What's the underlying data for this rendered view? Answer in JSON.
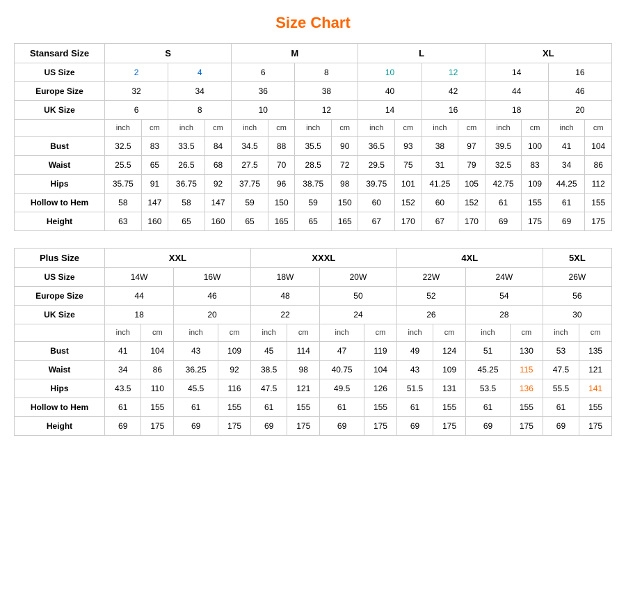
{
  "title": "Size Chart",
  "standard": {
    "label": "Stansard Size",
    "groups": [
      {
        "label": "S",
        "colspan": 4
      },
      {
        "label": "M",
        "colspan": 4
      },
      {
        "label": "L",
        "colspan": 4
      },
      {
        "label": "XL",
        "colspan": 4
      }
    ],
    "us_size": [
      "2",
      "4",
      "6",
      "8",
      "10",
      "12",
      "14",
      "16"
    ],
    "europe_size": [
      "32",
      "34",
      "36",
      "38",
      "40",
      "42",
      "44",
      "46"
    ],
    "uk_size": [
      "6",
      "8",
      "10",
      "12",
      "14",
      "16",
      "18",
      "20"
    ],
    "units": [
      "inch",
      "cm",
      "inch",
      "cm",
      "inch",
      "cm",
      "inch",
      "cm",
      "inch",
      "cm",
      "inch",
      "cm",
      "inch",
      "cm",
      "inch",
      "cm"
    ],
    "rows": [
      {
        "label": "Bust",
        "vals": [
          "32.5",
          "83",
          "33.5",
          "84",
          "34.5",
          "88",
          "35.5",
          "90",
          "36.5",
          "93",
          "38",
          "97",
          "39.5",
          "100",
          "41",
          "104"
        ]
      },
      {
        "label": "Waist",
        "vals": [
          "25.5",
          "65",
          "26.5",
          "68",
          "27.5",
          "70",
          "28.5",
          "72",
          "29.5",
          "75",
          "31",
          "79",
          "32.5",
          "83",
          "34",
          "86"
        ]
      },
      {
        "label": "Hips",
        "vals": [
          "35.75",
          "91",
          "36.75",
          "92",
          "37.75",
          "96",
          "38.75",
          "98",
          "39.75",
          "101",
          "41.25",
          "105",
          "42.75",
          "109",
          "44.25",
          "112"
        ]
      },
      {
        "label": "Hollow to Hem",
        "vals": [
          "58",
          "147",
          "58",
          "147",
          "59",
          "150",
          "59",
          "150",
          "60",
          "152",
          "60",
          "152",
          "61",
          "155",
          "61",
          "155"
        ]
      },
      {
        "label": "Height",
        "vals": [
          "63",
          "160",
          "65",
          "160",
          "65",
          "165",
          "65",
          "165",
          "67",
          "170",
          "67",
          "170",
          "69",
          "175",
          "69",
          "175"
        ]
      }
    ]
  },
  "plus": {
    "label": "Plus Size",
    "groups": [
      {
        "label": "XXL",
        "colspan": 4
      },
      {
        "label": "XXXL",
        "colspan": 4
      },
      {
        "label": "4XL",
        "colspan": 4
      },
      {
        "label": "5XL",
        "colspan": 2
      }
    ],
    "us_size": [
      "14W",
      "16W",
      "18W",
      "20W",
      "22W",
      "24W",
      "26W"
    ],
    "europe_size": [
      "44",
      "46",
      "48",
      "50",
      "52",
      "54",
      "56"
    ],
    "uk_size": [
      "18",
      "20",
      "22",
      "24",
      "26",
      "28",
      "30"
    ],
    "units": [
      "inch",
      "cm",
      "inch",
      "cm",
      "inch",
      "cm",
      "inch",
      "cm",
      "inch",
      "cm",
      "inch",
      "cm",
      "inch",
      "cm"
    ],
    "rows": [
      {
        "label": "Bust",
        "vals": [
          "41",
          "104",
          "43",
          "109",
          "45",
          "114",
          "47",
          "119",
          "49",
          "124",
          "51",
          "130",
          "53",
          "135"
        ]
      },
      {
        "label": "Waist",
        "vals": [
          "34",
          "86",
          "36.25",
          "92",
          "38.5",
          "98",
          "40.75",
          "104",
          "43",
          "109",
          "45.25",
          "115",
          "47.5",
          "121"
        ]
      },
      {
        "label": "Hips",
        "vals": [
          "43.5",
          "110",
          "45.5",
          "116",
          "47.5",
          "121",
          "49.5",
          "126",
          "51.5",
          "131",
          "53.5",
          "136",
          "55.5",
          "141"
        ]
      },
      {
        "label": "Hollow to Hem",
        "vals": [
          "61",
          "155",
          "61",
          "155",
          "61",
          "155",
          "61",
          "155",
          "61",
          "155",
          "61",
          "155",
          "61",
          "155"
        ]
      },
      {
        "label": "Height",
        "vals": [
          "69",
          "175",
          "69",
          "175",
          "69",
          "175",
          "69",
          "175",
          "69",
          "175",
          "69",
          "175",
          "69",
          "175"
        ]
      }
    ]
  }
}
